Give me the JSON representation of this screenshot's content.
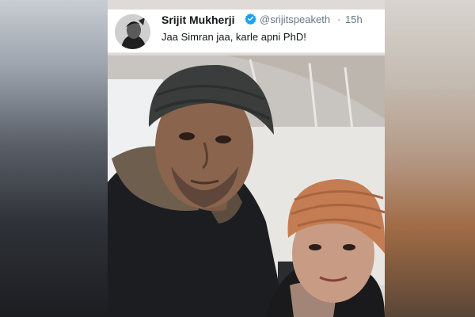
{
  "tweet": {
    "display_name": "Srijit Mukherji",
    "handle": "@srijitspeaketh",
    "separator": "·",
    "time": "15h",
    "text": "Jaa Simran jaa, karle apni PhD!"
  },
  "colors": {
    "verified_blue": "#1da1f2",
    "handle_gray": "#657786",
    "name_black": "#14171a"
  },
  "icons": {
    "verified": "verified-badge-icon"
  }
}
